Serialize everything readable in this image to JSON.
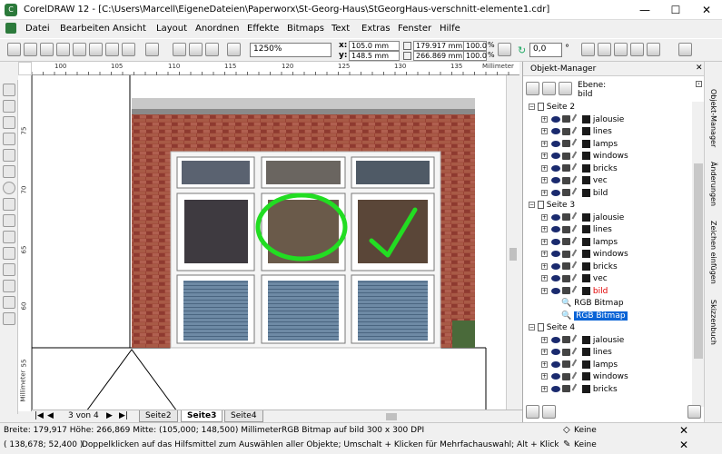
{
  "window": {
    "title": "CorelDRAW 12 - [C:\\Users\\Marcell\\EigeneDateien\\Paperworx\\St-Georg-Haus\\StGeorgHaus-verschnitt-elemente1.cdr]",
    "minimize": "—",
    "maximize": "☐",
    "close": "✕"
  },
  "menu": [
    "Datei",
    "Bearbeiten",
    "Ansicht",
    "Layout",
    "Anordnen",
    "Effekte",
    "Bitmaps",
    "Text",
    "Extras",
    "Fenster",
    "Hilfe"
  ],
  "toolbar": {
    "zoom": "1250%",
    "x_label": "x:",
    "x_value": "105.0 mm",
    "y_label": "y:",
    "y_value": "148.5 mm",
    "w_value": "179.917 mm",
    "h_value": "266.869 mm",
    "sx_value": "100.0",
    "sy_value": "100.0",
    "pct": "%",
    "angle_value": "0,0",
    "degree": "°"
  },
  "ruler": {
    "h_ticks": [
      "100",
      "105",
      "110",
      "115",
      "120",
      "125",
      "130",
      "135"
    ],
    "h_unit": "Millimeter",
    "v_ticks": [
      "75",
      "70",
      "65",
      "60",
      "55"
    ],
    "v_unit": "Millimeter"
  },
  "pagebar": {
    "page_counter": "3 von 4",
    "tabs": [
      "Seite2",
      "Seite3",
      "Seite4"
    ],
    "active_tab": "Seite3"
  },
  "status": {
    "line1": "Breite: 179,917 Höhe: 266,869 Mitte: (105,000; 148,500) Millimeter",
    "object_info": "RGB Bitmap auf bild 300 x 300 DPI",
    "line2_coords": "( 138,678; 52,400 )",
    "line2_hint": "Doppelklicken auf das Hilfsmittel zum Auswählen aller Objekte; Umschalt + Klicken für Mehrfachauswahl; Alt + Klicken zum Auswählen überdec...",
    "fill_label": "Keine",
    "outline_label": "Keine"
  },
  "docker": {
    "title": "Objekt-Manager",
    "layer_label": "Ebene:",
    "layer_value": "bild",
    "pages": [
      {
        "name": "Seite 2",
        "layers": [
          "jalousie",
          "lines",
          "lamps",
          "windows",
          "bricks",
          "vec",
          "bild"
        ]
      },
      {
        "name": "Seite 3",
        "layers": [
          "jalousie",
          "lines",
          "lamps",
          "windows",
          "bricks",
          "vec",
          "bild"
        ],
        "children": [
          "RGB Bitmap",
          "RGB Bitmap"
        ]
      },
      {
        "name": "Seite 4",
        "layers": [
          "jalousie",
          "lines",
          "lamps",
          "windows",
          "bricks"
        ]
      }
    ],
    "side_tabs": [
      "Objekt-Manager",
      "Änderungen",
      "Zeichen einfügen",
      "Skizzenbuch"
    ]
  },
  "colors": {
    "active_layer": "#e00000",
    "selection": "#0a64d6",
    "circle": "#22dd22",
    "check": "#22dd22",
    "brick": "#a04a3a"
  }
}
